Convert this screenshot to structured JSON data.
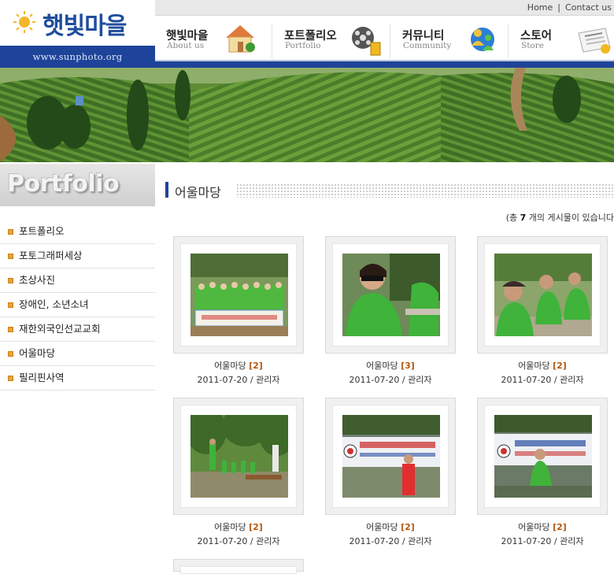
{
  "header": {
    "logo_text": "햇빛마을",
    "url": "www.sunphoto.org",
    "top_links": [
      "Home",
      "|",
      "Contact us"
    ]
  },
  "nav": [
    {
      "ko": "햇빛마을",
      "en": "About us",
      "icon": "house-icon"
    },
    {
      "ko": "포트폴리오",
      "en": "Portfolio",
      "icon": "film-reel-icon"
    },
    {
      "ko": "커뮤니티",
      "en": "Community",
      "icon": "people-icon"
    },
    {
      "ko": "스토어",
      "en": "Store",
      "icon": "newspaper-icon"
    }
  ],
  "sidebar": {
    "title": "Portfolio",
    "items": [
      "포트폴리오",
      "포토그래퍼세상",
      "초상사진",
      "장애인, 소년소녀",
      "재한외국인선교교회",
      "어울마당",
      "필리핀사역"
    ]
  },
  "main": {
    "title": "어울마당",
    "count_prefix": "(총",
    "count": "7",
    "count_suffix": "개의 게시물이 있습니다",
    "posts": [
      {
        "title": "어울마당",
        "comments": "[2]",
        "meta": "2011-07-20 / 관리자"
      },
      {
        "title": "어울마당",
        "comments": "[3]",
        "meta": "2011-07-20 / 관리자"
      },
      {
        "title": "어울마당",
        "comments": "[2]",
        "meta": "2011-07-20 / 관리자"
      },
      {
        "title": "어울마당",
        "comments": "[2]",
        "meta": "2011-07-20 / 관리자"
      },
      {
        "title": "어울마당",
        "comments": "[2]",
        "meta": "2011-07-20 / 관리자"
      },
      {
        "title": "어울마당",
        "comments": "[2]",
        "meta": "2011-07-20 / 관리자"
      }
    ]
  },
  "colors": {
    "brand_blue": "#1e449a",
    "accent_orange": "#e9a23b",
    "shirt_green": "#3fae3a"
  }
}
